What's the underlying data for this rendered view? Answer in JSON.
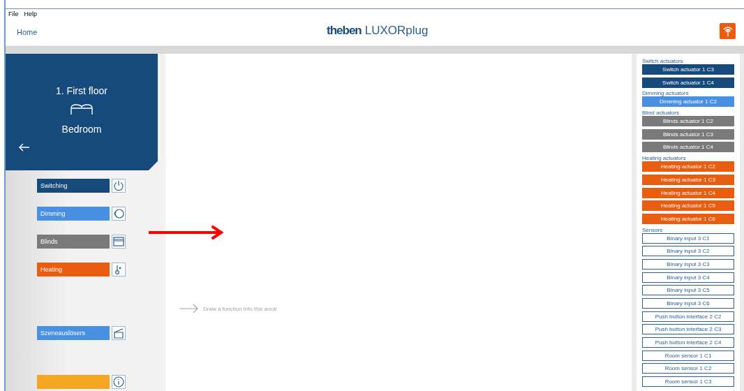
{
  "menu": [
    "File",
    "Help"
  ],
  "header": {
    "home": "Home",
    "brand": "theben",
    "product": "LUXORplug"
  },
  "room": {
    "floor": "1. First floor",
    "name": "Bedroom"
  },
  "functions": [
    {
      "label": "Switching",
      "color": "#174a7c",
      "kind": "power"
    },
    {
      "label": "Dimming",
      "color": "#4a90e2",
      "kind": "dimmer"
    },
    {
      "label": "Blinds",
      "color": "#7a7a7a",
      "kind": "blinds"
    },
    {
      "label": "Heating",
      "color": "#e85d10",
      "kind": "thermometer"
    },
    {
      "label": "Szeneauslösers",
      "color": "#4a90e2",
      "kind": "scene"
    },
    {
      "color": "#f5a623",
      "kind": "info"
    }
  ],
  "canvas": {
    "hint": "Draw a function into this area!"
  },
  "device_groups": [
    {
      "title": "Switch actuators",
      "kind": "filled",
      "color": "#174a7c",
      "items": [
        "Switch actuator 1 C3",
        "Switch actuator 1 C4"
      ]
    },
    {
      "title": "Dimming actuators",
      "kind": "filled",
      "color": "#4a90e2",
      "items": [
        "Dimming actuator 1 C2"
      ]
    },
    {
      "title": "Blind actuators",
      "kind": "filled",
      "color": "#7a7a7a",
      "items": [
        "Blinds actuator 1 C2",
        "Blinds actuator 1 C3",
        "Blinds actuator 1 C4"
      ]
    },
    {
      "title": "Heating actuators",
      "kind": "filled",
      "color": "#e85d10",
      "items": [
        "Heating actuator 1 C2",
        "Heating actuator 1 C3",
        "Heating actuator 1 C4",
        "Heating actuator 1 C5",
        "Heating actuator 1 C6"
      ]
    },
    {
      "title": "Sensors",
      "kind": "outline",
      "color": "#2a5d92",
      "items": [
        "Binary input 3 C1",
        "Binary input 3 C2",
        "Binary input 3 C3",
        "Binary input 3 C4",
        "Binary input 3 C5",
        "Binary input 3 C6",
        "Push button interface 2 C2",
        "Push button interface 2 C3",
        "Push button interface 2 C4",
        "Room sensor 1 C1",
        "Room sensor 1 C2",
        "Room sensor 1 C3"
      ]
    }
  ]
}
